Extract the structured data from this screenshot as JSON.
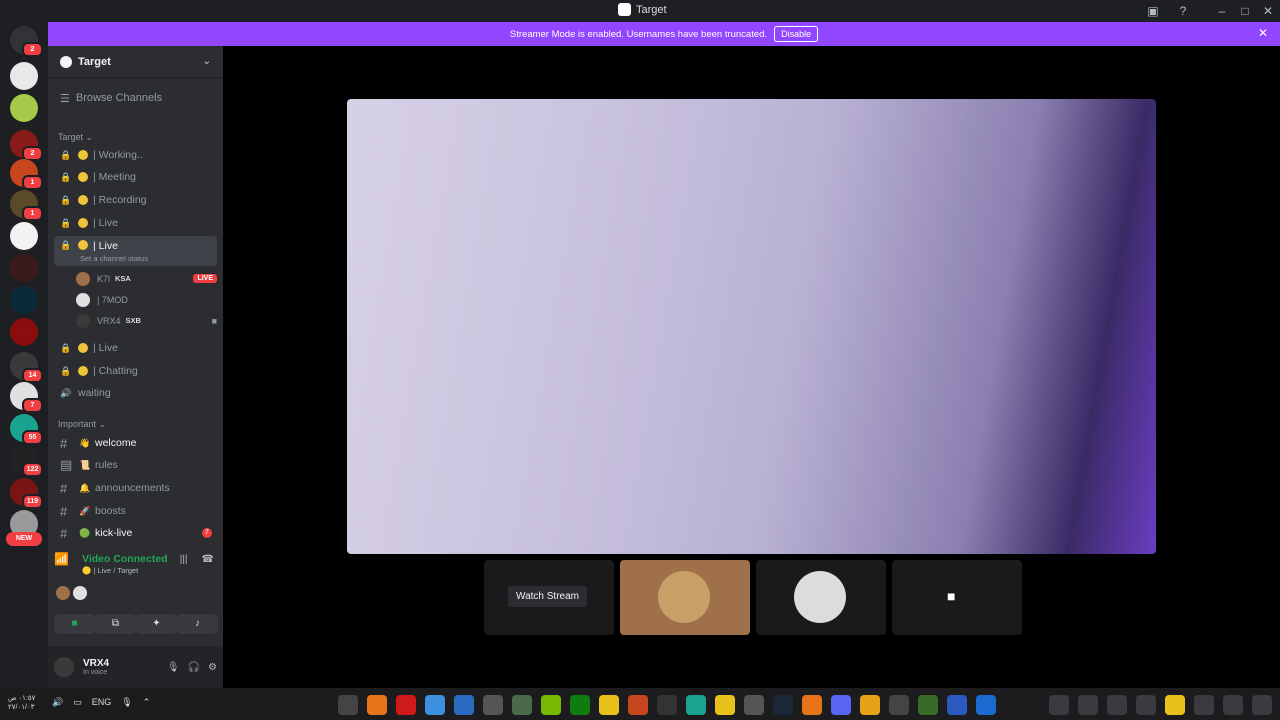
{
  "window": {
    "title": "Target"
  },
  "banner": {
    "message": "Streamer Mode is enabled. Usernames have been truncated.",
    "disable_label": "Disable"
  },
  "rail": {
    "badges": [
      "2",
      "2",
      "1",
      "1",
      "14",
      "7",
      "55",
      "122",
      "119"
    ],
    "new_label": "NEW"
  },
  "server": {
    "name": "Target",
    "browse_label": "Browse Channels"
  },
  "categories": {
    "target": "Target",
    "important": "Important"
  },
  "voice_channels": [
    {
      "label": "| Working.."
    },
    {
      "label": "| Meeting"
    },
    {
      "label": "| Recording"
    },
    {
      "label": "| Live"
    },
    {
      "label": "| Live",
      "status": "Set a channel status"
    },
    {
      "label": "| Live"
    },
    {
      "label": "| Chatting"
    },
    {
      "label": "waiting"
    }
  ],
  "voice_users": [
    {
      "name": "K7l",
      "tag": "KSA",
      "badge": "LIVE"
    },
    {
      "name": "| 7MOD"
    },
    {
      "name": "VRX4",
      "tag": "SXB"
    }
  ],
  "text_channels": [
    {
      "label": "welcome"
    },
    {
      "label": "rules"
    },
    {
      "label": "announcements"
    },
    {
      "label": "boosts"
    },
    {
      "label": "kick-live",
      "mentions": "7"
    }
  ],
  "voice_panel": {
    "status": "Video Connected",
    "location": "| Live / Target"
  },
  "user_panel": {
    "name": "VRX4",
    "status": "In voice"
  },
  "stage": {
    "watch_label": "Watch Stream"
  },
  "taskbar": {
    "time": "٠١:٥٧ ص",
    "date": "٢٧/٠١/٠٣",
    "lang": "ENG"
  },
  "colors": {
    "streamer_banner": "#9146ff",
    "connected": "#23a55a",
    "live_badge": "#f23f43"
  }
}
